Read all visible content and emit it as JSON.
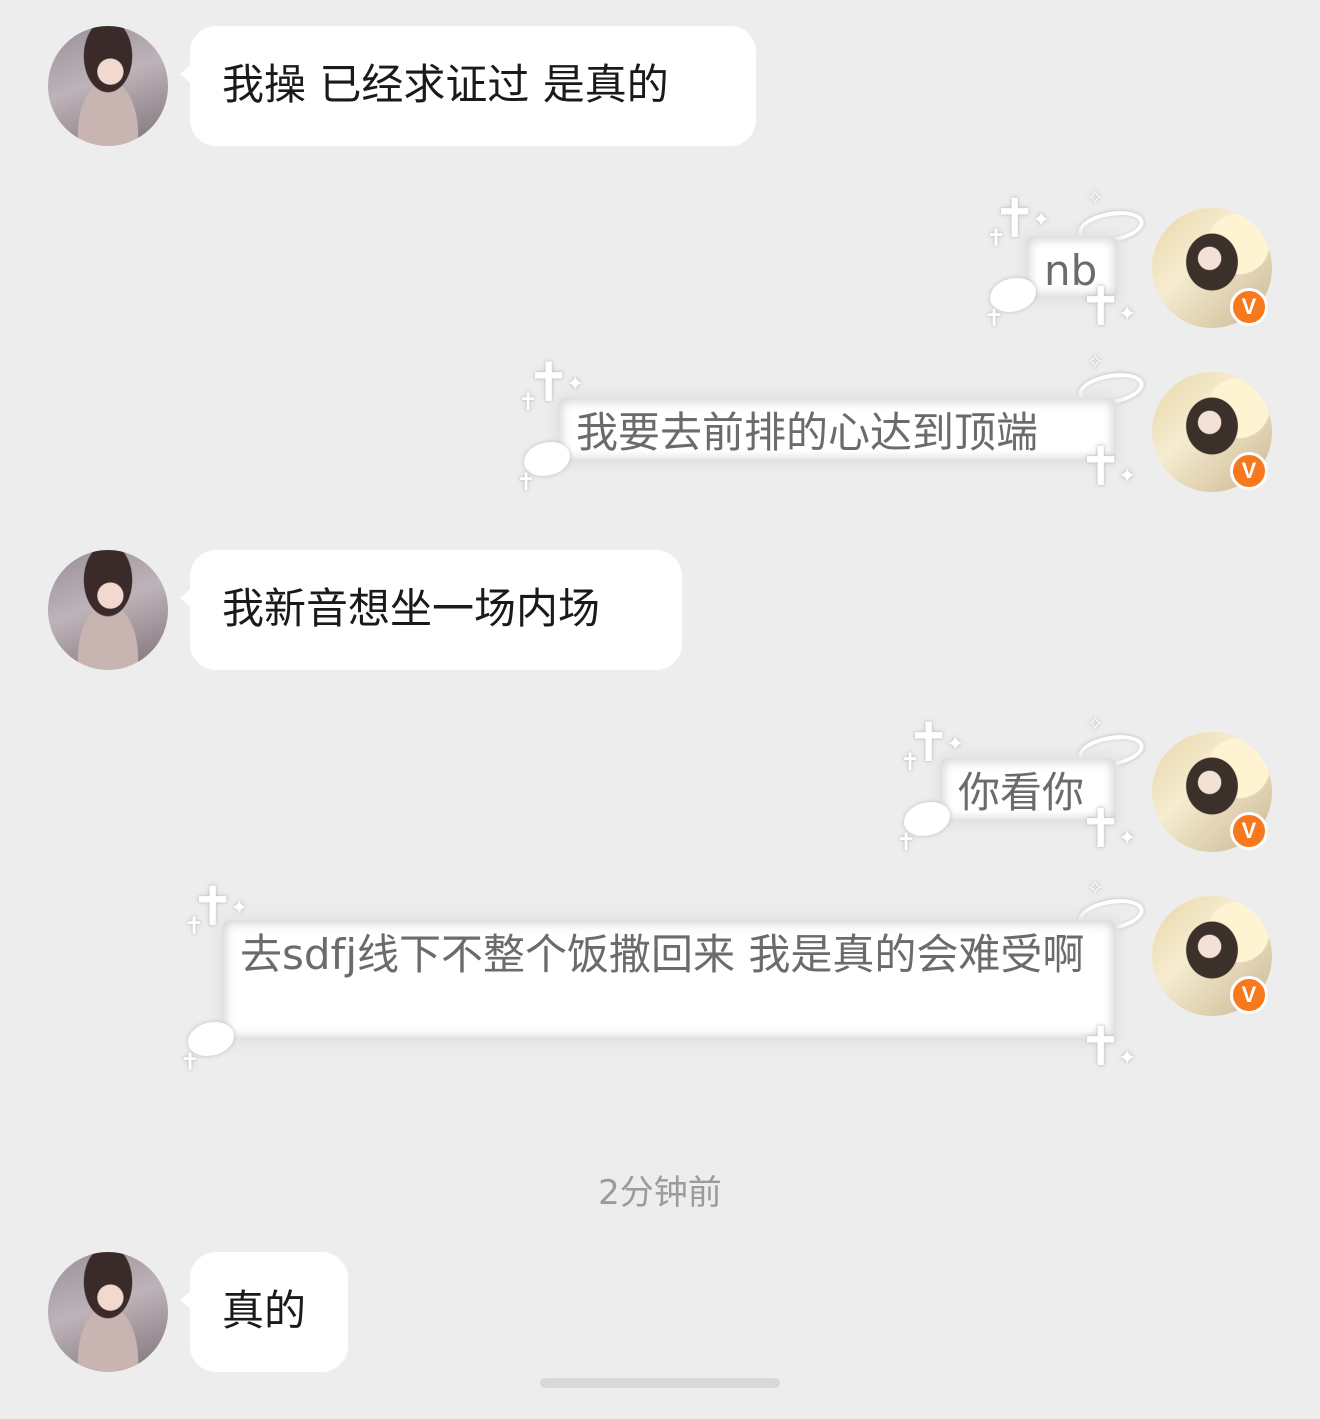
{
  "messages": [
    {
      "side": "in",
      "text": "我操 已经求证过 是真的"
    },
    {
      "side": "out",
      "text": "nb"
    },
    {
      "side": "out",
      "text": "我要去前排的心达到顶端"
    },
    {
      "side": "in",
      "text": "我新音想坐一场内场"
    },
    {
      "side": "out",
      "text": "你看你"
    },
    {
      "side": "out",
      "text": "去sdfj线下不整个饭撒回来 我是真的会难受啊"
    },
    {
      "side": "in",
      "text": "真的"
    }
  ],
  "timestamp": "2分钟前",
  "badge_label": "V",
  "colors": {
    "background": "#ededed",
    "bubble": "#ffffff",
    "badge": "#f7781d",
    "timestamp": "#9b9b9b"
  },
  "icons": [
    "avatar-other",
    "avatar-self",
    "verified-badge-icon",
    "cross-icon",
    "halo-icon",
    "wing-icon",
    "star-icon"
  ]
}
